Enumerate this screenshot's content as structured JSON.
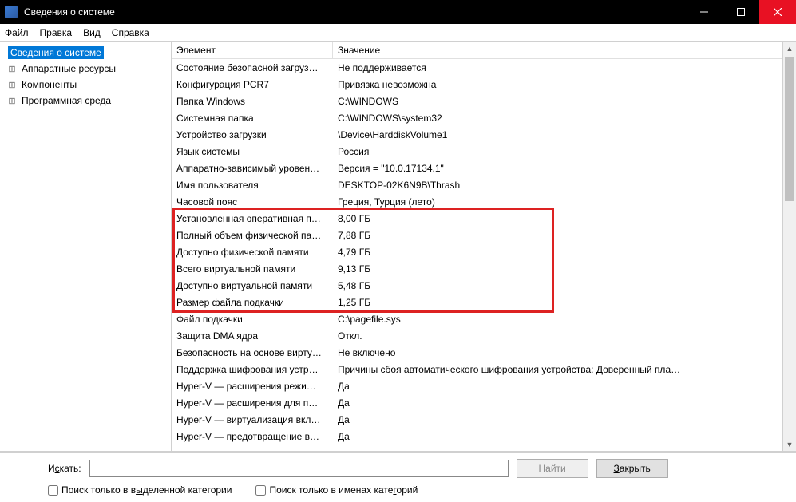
{
  "window": {
    "title": "Сведения о системе"
  },
  "menu": {
    "file": "Файл",
    "edit": "Правка",
    "view": "Вид",
    "help": "Справка"
  },
  "tree": {
    "root": "Сведения о системе",
    "items": [
      {
        "label": "Аппаратные ресурсы"
      },
      {
        "label": "Компоненты"
      },
      {
        "label": "Программная среда"
      }
    ]
  },
  "columns": {
    "element": "Элемент",
    "value": "Значение"
  },
  "rows": [
    {
      "k": "Состояние безопасной загруз…",
      "v": "Не поддерживается"
    },
    {
      "k": "Конфигурация PCR7",
      "v": "Привязка невозможна"
    },
    {
      "k": "Папка Windows",
      "v": "C:\\WINDOWS"
    },
    {
      "k": "Системная папка",
      "v": "C:\\WINDOWS\\system32"
    },
    {
      "k": "Устройство загрузки",
      "v": "\\Device\\HarddiskVolume1"
    },
    {
      "k": "Язык системы",
      "v": "Россия"
    },
    {
      "k": "Аппаратно-зависимый уровен…",
      "v": "Версия = \"10.0.17134.1\""
    },
    {
      "k": "Имя пользователя",
      "v": "DESKTOP-02K6N9B\\Thrash"
    },
    {
      "k": "Часовой пояс",
      "v": "Греция, Турция (лето)"
    },
    {
      "k": "Установленная оперативная п…",
      "v": "8,00 ГБ"
    },
    {
      "k": "Полный объем физической па…",
      "v": "7,88 ГБ"
    },
    {
      "k": "Доступно физической памяти",
      "v": "4,79 ГБ"
    },
    {
      "k": "Всего виртуальной памяти",
      "v": "9,13 ГБ"
    },
    {
      "k": "Доступно виртуальной памяти",
      "v": "5,48 ГБ"
    },
    {
      "k": "Размер файла подкачки",
      "v": "1,25 ГБ"
    },
    {
      "k": "Файл подкачки",
      "v": "C:\\pagefile.sys"
    },
    {
      "k": "Защита DMA ядра",
      "v": "Откл."
    },
    {
      "k": "Безопасность на основе вирту…",
      "v": "Не включено"
    },
    {
      "k": "Поддержка шифрования устр…",
      "v": "Причины сбоя автоматического шифрования устройства: Доверенный пла…"
    },
    {
      "k": "Hyper-V — расширения режи…",
      "v": "Да"
    },
    {
      "k": "Hyper-V — расширения для п…",
      "v": "Да"
    },
    {
      "k": "Hyper-V — виртуализация вкл…",
      "v": "Да"
    },
    {
      "k": "Hyper-V — предотвращение в…",
      "v": "Да"
    }
  ],
  "search": {
    "label_pre": "И",
    "label_u": "с",
    "label_post": "кать:",
    "find": "Найти",
    "close_pre": "",
    "close_u": "З",
    "close_post": "акрыть",
    "chk1_pre": "Поиск только в в",
    "chk1_u": "ы",
    "chk1_post": "деленной категории",
    "chk2_pre": "Поиск только в именах кате",
    "chk2_u": "г",
    "chk2_post": "орий"
  }
}
